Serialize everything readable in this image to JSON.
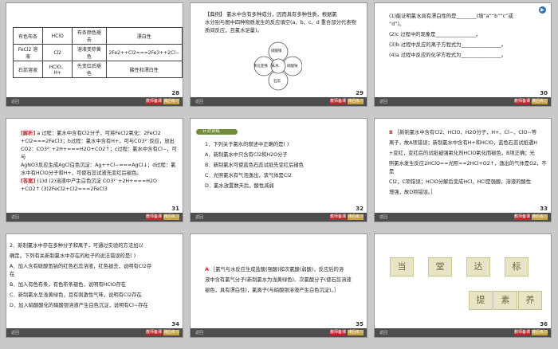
{
  "slides": {
    "s28": {
      "number": "28",
      "headers": [
        "有色布条",
        "HClO",
        "布条颜色褪去",
        "漂白性"
      ],
      "row1": [
        "FeCl2 溶液",
        "Cl2",
        "溶液变棕黄色",
        "2Fe2++Cl2===2Fe3++2Cl−"
      ],
      "row2": [
        "石蕊溶液",
        "HClO、H+",
        "先变红后褪色",
        "酸性和漂白性"
      ]
    },
    "s29": {
      "number": "29",
      "lines": [
        "【典例】  氯水中含有多种成分，因而具有多种性质，根据氯",
        "水分别与图中四种物质发生的反应填空(a、b、c、d 重合部分代表物",
        "质间反应，且氯水足量)。"
      ],
      "center": "氯水",
      "nodes": [
        "硝酸银",
        "碳酸钠",
        "氯化亚铁",
        "石蕊"
      ]
    },
    "s30": {
      "number": "30",
      "lines": [
        "(1)能证明氯水具有漂白性的是________(填“a”“b”“c”或",
        "“d”)。",
        "(2)c 过程中的现象是________________。",
        "(3)b 过程中反应的离子方程式为________________。",
        "(4)a 过程中反应的化学方程式为________________。"
      ]
    },
    "s31": {
      "number": "31",
      "label": "[解析]",
      "lines": [
        "a 过程：氯水中含有Cl2分子，可将FeCl2氧化：2FeCl2",
        "+Cl2===2FeCl3；b过程：氯水中含有H+，可与CO3²⁻反应，放出",
        "CO2：CO3²⁻+2H+===H2O+CO2↑；c过程：氯水中含有Cl−，可与",
        "AgNO3反应生成AgCl白色沉淀：Ag++Cl−===AgCl↓；d过程：氯",
        "水中有HClO分子和H+，可使石蕊试液先变红后褪色。"
      ],
      "answer_label": "[答案]",
      "answer_lines": [
        "(1)d  (2)溶液中产生白色沉淀    CO3²⁻+2H+===H2O",
        "+CO2↑   (3)2FeCl2+Cl2===2FeCl3"
      ]
    },
    "s32": {
      "number": "32",
      "band": "针对训练",
      "lines": [
        "1．下列关于氯水的叙述中正确的是(    )",
        "A．新制氯水中只含有Cl2和H2O分子",
        "B．新制氯水可使蓝色石蕊试纸先变红后褪色",
        "C．光照氯水有气泡逸出，该气体是Cl2",
        "D．氯水放置数天后，酸性减弱"
      ]
    },
    "s33": {
      "number": "33",
      "label": "B",
      "lines": [
        "［新制氯水中含有Cl2、HClO、H2O分子，H+、Cl−、ClO−等",
        "离子，故A项错误；新制氯水中含有H+和HClO，蓝色石蕊试纸遇H",
        "+变红，变红后的试纸被强氧化剂HClO氧化而褪色，B项正确；光",
        "照氯水发生反应2HClO==光照==2HCl+O2↑，逸出的气体是O2，不是",
        "Cl2，C项错误；HClO分解后变成HCl，HCl是强酸，溶液的酸性",
        "增强，故D项错误。］"
      ]
    },
    "s34": {
      "number": "34",
      "lines": [
        "2．新制氯水中存在多种分子和离子，可通过实验的方法加以",
        "确定。下列有关新制氯水中存在的粒子的说法错误的是(    )",
        "A．加入含有硫酸氢钠的红色石蕊溶液，红色褪去，说明有Cl2存",
        "在",
        "B．加入有色布条，有色布条褪色，说明有HClO存在",
        "C．新制氯水呈浅黄绿色，且有刺激性气味，说明有Cl2存在",
        "D．加入硝酸酸化的硝酸银溶液产生白色沉淀，说明有Cl−存在"
      ]
    },
    "s35": {
      "number": "35",
      "label": "A",
      "lines": [
        "［氯气与水反应生成盐酸(强酸)和次氯酸(弱酸)，反应后的溶",
        "液中含有氯气分子(新制氯水为浅黄绿色)、次氯酸分子(使石蕊溶液",
        "褪色，具有漂白性)，氯离子(与硝酸银溶液产生白色沉淀)。］"
      ]
    },
    "s36": {
      "number": "36",
      "title_chars": [
        "当",
        "堂",
        "达",
        "标"
      ],
      "sub_chars": [
        "提",
        "素",
        "养"
      ]
    }
  },
  "footer": {
    "tag_red": "教师备课",
    "tag_gold": "课后练习",
    "nav": "返回"
  },
  "colors": {
    "accent_red": "#c0272d",
    "accent_blue": "#2e6db4",
    "gold": "#c8a040"
  }
}
